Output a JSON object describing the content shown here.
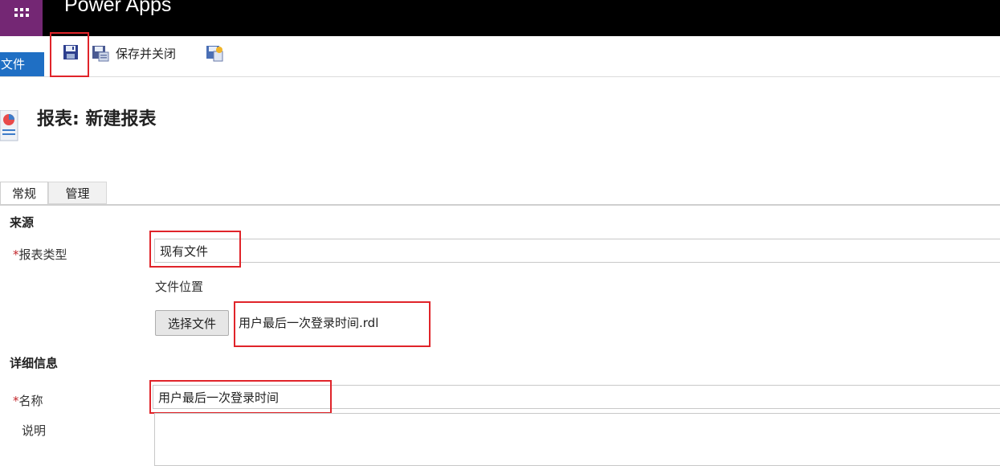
{
  "app": {
    "title": "Power Apps"
  },
  "ribbon": {
    "file_tab": "文件",
    "save_close_label": "保存并关闭"
  },
  "page": {
    "title": "报表: 新建报表"
  },
  "tabs": [
    {
      "label": "常规"
    },
    {
      "label": "管理"
    }
  ],
  "source": {
    "heading": "来源",
    "report_type": {
      "required_mark": "*",
      "label": "报表类型",
      "value": "现有文件"
    },
    "file_location": {
      "label": "文件位置",
      "button": "选择文件",
      "file_name": "用户最后一次登录时间.rdl"
    }
  },
  "details": {
    "heading": "详细信息",
    "name": {
      "required_mark": "*",
      "label": "名称",
      "value": "用户最后一次登录时间"
    },
    "description": {
      "label": "说明",
      "value": ""
    }
  },
  "colors": {
    "brand": "#742774",
    "file_tab": "#1f6fc4",
    "highlight": "#e0242a",
    "required": "#c2262b"
  }
}
